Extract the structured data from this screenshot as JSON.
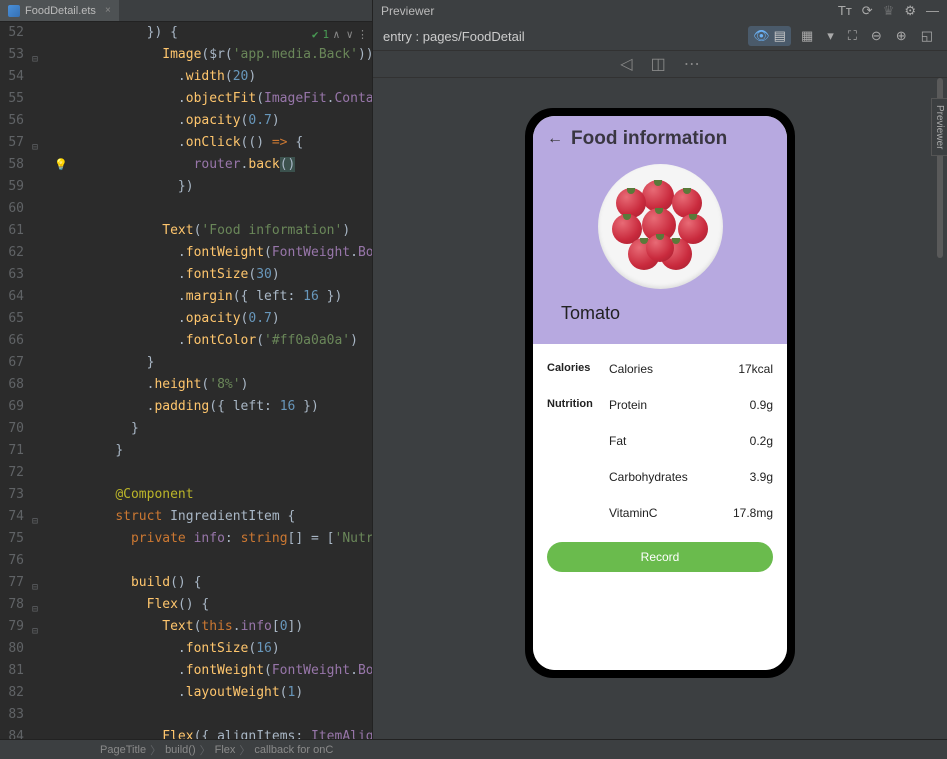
{
  "editor": {
    "tab_name": "FoodDetail.ets",
    "check_count": "1",
    "line_start": 52,
    "lines": [
      {
        "n": 52,
        "indent": 4,
        "segs": [
          {
            "t": "}) {",
            "c": "paren"
          }
        ]
      },
      {
        "n": 53,
        "indent": 5,
        "segs": [
          {
            "t": "Image",
            "c": "fn"
          },
          {
            "t": "(",
            "c": "paren"
          },
          {
            "t": "$r",
            "c": "id"
          },
          {
            "t": "(",
            "c": "paren"
          },
          {
            "t": "'app.media.Back'",
            "c": "str"
          },
          {
            "t": "))",
            "c": "paren"
          }
        ]
      },
      {
        "n": 54,
        "indent": 6,
        "segs": [
          {
            "t": ".",
            "c": "id"
          },
          {
            "t": "width",
            "c": "fn"
          },
          {
            "t": "(",
            "c": "paren"
          },
          {
            "t": "20",
            "c": "num"
          },
          {
            "t": ")",
            "c": "paren"
          }
        ]
      },
      {
        "n": 55,
        "indent": 6,
        "segs": [
          {
            "t": ".",
            "c": "id"
          },
          {
            "t": "objectFit",
            "c": "fn"
          },
          {
            "t": "(",
            "c": "paren"
          },
          {
            "t": "ImageFit",
            "c": "purple"
          },
          {
            "t": ".",
            "c": "id"
          },
          {
            "t": "Contain",
            "c": "purple"
          },
          {
            "t": ")",
            "c": "paren"
          }
        ]
      },
      {
        "n": 56,
        "indent": 6,
        "segs": [
          {
            "t": ".",
            "c": "id"
          },
          {
            "t": "opacity",
            "c": "fn"
          },
          {
            "t": "(",
            "c": "paren"
          },
          {
            "t": "0.7",
            "c": "num"
          },
          {
            "t": ")",
            "c": "paren"
          }
        ]
      },
      {
        "n": 57,
        "indent": 6,
        "segs": [
          {
            "t": ".",
            "c": "id"
          },
          {
            "t": "onClick",
            "c": "fn"
          },
          {
            "t": "(() ",
            "c": "paren"
          },
          {
            "t": "=>",
            "c": "kw"
          },
          {
            "t": " {",
            "c": "paren"
          }
        ]
      },
      {
        "n": 58,
        "indent": 7,
        "segs": [
          {
            "t": "router",
            "c": "purple"
          },
          {
            "t": ".",
            "c": "id"
          },
          {
            "t": "back",
            "c": "fn"
          },
          {
            "t": "(",
            "c": "hl-paren"
          },
          {
            "t": ")",
            "c": "hl-paren"
          }
        ],
        "bulb": true
      },
      {
        "n": 59,
        "indent": 6,
        "segs": [
          {
            "t": "})",
            "c": "paren"
          }
        ]
      },
      {
        "n": 60,
        "indent": 0,
        "segs": []
      },
      {
        "n": 61,
        "indent": 5,
        "segs": [
          {
            "t": "Text",
            "c": "fn"
          },
          {
            "t": "(",
            "c": "paren"
          },
          {
            "t": "'Food information'",
            "c": "str"
          },
          {
            "t": ")",
            "c": "paren"
          }
        ]
      },
      {
        "n": 62,
        "indent": 6,
        "segs": [
          {
            "t": ".",
            "c": "id"
          },
          {
            "t": "fontWeight",
            "c": "fn"
          },
          {
            "t": "(",
            "c": "paren"
          },
          {
            "t": "FontWeight",
            "c": "purple"
          },
          {
            "t": ".",
            "c": "id"
          },
          {
            "t": "Bold",
            "c": "purple"
          },
          {
            "t": ")",
            "c": "paren"
          }
        ]
      },
      {
        "n": 63,
        "indent": 6,
        "segs": [
          {
            "t": ".",
            "c": "id"
          },
          {
            "t": "fontSize",
            "c": "fn"
          },
          {
            "t": "(",
            "c": "paren"
          },
          {
            "t": "30",
            "c": "num"
          },
          {
            "t": ")",
            "c": "paren"
          }
        ]
      },
      {
        "n": 64,
        "indent": 6,
        "segs": [
          {
            "t": ".",
            "c": "id"
          },
          {
            "t": "margin",
            "c": "fn"
          },
          {
            "t": "({ ",
            "c": "paren"
          },
          {
            "t": "left",
            "c": "id"
          },
          {
            "t": ": ",
            "c": "id"
          },
          {
            "t": "16",
            "c": "num"
          },
          {
            "t": " })",
            "c": "paren"
          }
        ]
      },
      {
        "n": 65,
        "indent": 6,
        "segs": [
          {
            "t": ".",
            "c": "id"
          },
          {
            "t": "opacity",
            "c": "fn"
          },
          {
            "t": "(",
            "c": "paren"
          },
          {
            "t": "0.7",
            "c": "num"
          },
          {
            "t": ")",
            "c": "paren"
          }
        ]
      },
      {
        "n": 66,
        "indent": 6,
        "segs": [
          {
            "t": ".",
            "c": "id"
          },
          {
            "t": "fontColor",
            "c": "fn"
          },
          {
            "t": "(",
            "c": "paren"
          },
          {
            "t": "'#ff0a0a0a'",
            "c": "str"
          },
          {
            "t": ")",
            "c": "paren"
          }
        ],
        "bp": true
      },
      {
        "n": 67,
        "indent": 4,
        "segs": [
          {
            "t": "}",
            "c": "paren"
          }
        ]
      },
      {
        "n": 68,
        "indent": 4,
        "segs": [
          {
            "t": ".",
            "c": "id"
          },
          {
            "t": "height",
            "c": "fn"
          },
          {
            "t": "(",
            "c": "paren"
          },
          {
            "t": "'8%'",
            "c": "str"
          },
          {
            "t": ")",
            "c": "paren"
          }
        ]
      },
      {
        "n": 69,
        "indent": 4,
        "segs": [
          {
            "t": ".",
            "c": "id"
          },
          {
            "t": "padding",
            "c": "fn"
          },
          {
            "t": "({ ",
            "c": "paren"
          },
          {
            "t": "left",
            "c": "id"
          },
          {
            "t": ": ",
            "c": "id"
          },
          {
            "t": "16",
            "c": "num"
          },
          {
            "t": " })",
            "c": "paren"
          }
        ]
      },
      {
        "n": 70,
        "indent": 3,
        "segs": [
          {
            "t": "}",
            "c": "paren"
          }
        ]
      },
      {
        "n": 71,
        "indent": 2,
        "segs": [
          {
            "t": "}",
            "c": "paren"
          }
        ]
      },
      {
        "n": 72,
        "indent": 0,
        "segs": []
      },
      {
        "n": 73,
        "indent": 2,
        "segs": [
          {
            "t": "@Component",
            "c": "ann"
          }
        ]
      },
      {
        "n": 74,
        "indent": 2,
        "segs": [
          {
            "t": "struct ",
            "c": "kw"
          },
          {
            "t": "IngredientItem",
            "c": "typ"
          },
          {
            "t": " {",
            "c": "paren"
          }
        ]
      },
      {
        "n": 75,
        "indent": 3,
        "segs": [
          {
            "t": "private ",
            "c": "kw"
          },
          {
            "t": "info",
            "c": "purple"
          },
          {
            "t": ": ",
            "c": "id"
          },
          {
            "t": "string",
            "c": "kw"
          },
          {
            "t": "[] = [",
            "c": "paren"
          },
          {
            "t": "'Nutri",
            "c": "str"
          }
        ]
      },
      {
        "n": 76,
        "indent": 0,
        "segs": []
      },
      {
        "n": 77,
        "indent": 3,
        "segs": [
          {
            "t": "build",
            "c": "fn"
          },
          {
            "t": "() {",
            "c": "paren"
          }
        ]
      },
      {
        "n": 78,
        "indent": 4,
        "segs": [
          {
            "t": "Flex",
            "c": "fn"
          },
          {
            "t": "() {",
            "c": "paren"
          }
        ]
      },
      {
        "n": 79,
        "indent": 5,
        "segs": [
          {
            "t": "Text",
            "c": "fn"
          },
          {
            "t": "(",
            "c": "paren"
          },
          {
            "t": "this",
            "c": "kw"
          },
          {
            "t": ".",
            "c": "id"
          },
          {
            "t": "info",
            "c": "purple"
          },
          {
            "t": "[",
            "c": "paren"
          },
          {
            "t": "0",
            "c": "num"
          },
          {
            "t": "])",
            "c": "paren"
          }
        ]
      },
      {
        "n": 80,
        "indent": 6,
        "segs": [
          {
            "t": ".",
            "c": "id"
          },
          {
            "t": "fontSize",
            "c": "fn"
          },
          {
            "t": "(",
            "c": "paren"
          },
          {
            "t": "16",
            "c": "num"
          },
          {
            "t": ")",
            "c": "paren"
          }
        ]
      },
      {
        "n": 81,
        "indent": 6,
        "segs": [
          {
            "t": ".",
            "c": "id"
          },
          {
            "t": "fontWeight",
            "c": "fn"
          },
          {
            "t": "(",
            "c": "paren"
          },
          {
            "t": "FontWeight",
            "c": "purple"
          },
          {
            "t": ".",
            "c": "id"
          },
          {
            "t": "Bo",
            "c": "purple"
          }
        ]
      },
      {
        "n": 82,
        "indent": 6,
        "segs": [
          {
            "t": ".",
            "c": "id"
          },
          {
            "t": "layoutWeight",
            "c": "fn"
          },
          {
            "t": "(",
            "c": "paren"
          },
          {
            "t": "1",
            "c": "num"
          },
          {
            "t": ")",
            "c": "paren"
          }
        ]
      },
      {
        "n": 83,
        "indent": 0,
        "segs": []
      },
      {
        "n": 84,
        "indent": 5,
        "segs": [
          {
            "t": "Flex",
            "c": "fn"
          },
          {
            "t": "({ ",
            "c": "paren"
          },
          {
            "t": "alignItems",
            "c": "id"
          },
          {
            "t": ": ",
            "c": "id"
          },
          {
            "t": "ItemAlign",
            "c": "purple"
          }
        ]
      }
    ],
    "breadcrumbs": [
      "PageTitle",
      "build()",
      "Flex",
      "callback for onC"
    ]
  },
  "previewer": {
    "title": "Previewer",
    "entry": "entry : pages/FoodDetail",
    "side_tab": "Previewer"
  },
  "app": {
    "title": "Food information",
    "food_name": "Tomato",
    "record_button": "Record",
    "rows": [
      {
        "label": "Calories",
        "key": "Calories",
        "val": "17kcal"
      },
      {
        "label": "Nutrition",
        "key": "Protein",
        "val": "0.9g"
      },
      {
        "label": "",
        "key": "Fat",
        "val": "0.2g"
      },
      {
        "label": "",
        "key": "Carbohydrates",
        "val": "3.9g"
      },
      {
        "label": "",
        "key": "VitaminC",
        "val": "17.8mg"
      }
    ]
  }
}
